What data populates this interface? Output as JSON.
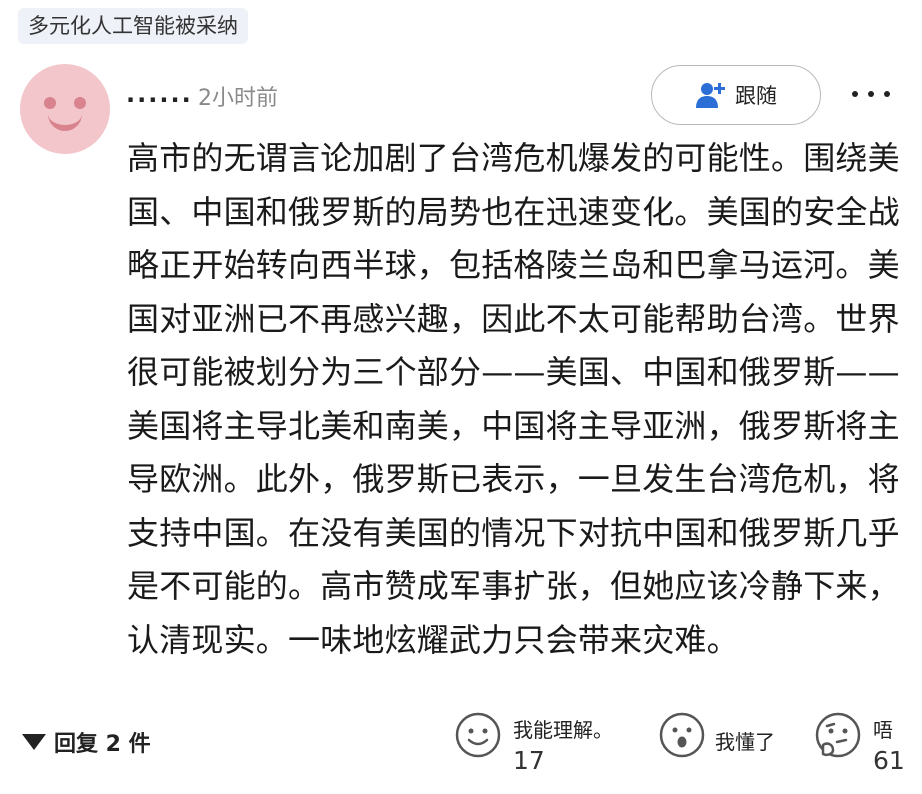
{
  "tag": {
    "label": "多元化人工智能被采纳"
  },
  "comment": {
    "username": "......",
    "time": "2小时前",
    "follow_label": "跟随",
    "text": "高市的无谓言论加剧了台湾危机爆发的可能性。围绕美国、中国和俄罗斯的局势也在迅速变化。美国的安全战略正开始转向西半球，包括格陵兰岛和巴拿马运河。美国对亚洲已不再感兴趣，因此不太可能帮助台湾。世界很可能被划分为三个部分——美国、中国和俄罗斯——美国将主导北美和南美，中国将主导亚洲，俄罗斯将主导欧洲。此外，俄罗斯已表示，一旦发生台湾危机，将支持中国。在没有美国的情况下对抗中国和俄罗斯几乎是不可能的。高市赞成军事扩张，但她应该冷静下来，认清现实。一味地炫耀武力只会带来灾难。"
  },
  "footer": {
    "reply_label": "回复 2 件",
    "reactions": [
      {
        "icon": "smile-face-icon",
        "label": "我能理解。",
        "count": "17"
      },
      {
        "icon": "surprised-face-icon",
        "label": "我懂了",
        "count": ""
      },
      {
        "icon": "thinking-face-icon",
        "label": "唔",
        "count": "61"
      }
    ]
  }
}
